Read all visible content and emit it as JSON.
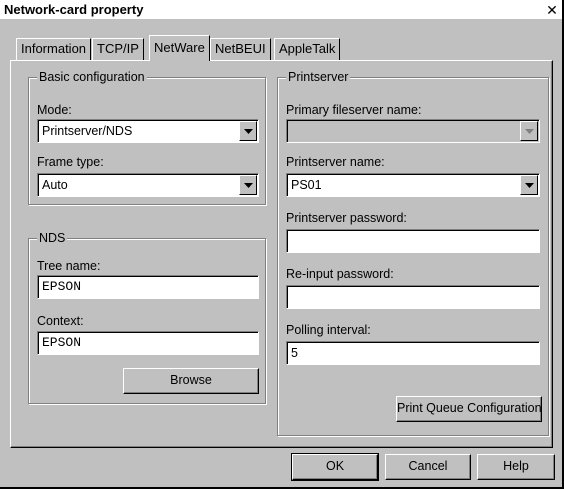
{
  "window": {
    "title": "Network-card property",
    "close_glyph": "✕"
  },
  "tabs": [
    {
      "label": "Information"
    },
    {
      "label": "TCP/IP"
    },
    {
      "label": "NetWare"
    },
    {
      "label": "NetBEUI"
    },
    {
      "label": "AppleTalk"
    }
  ],
  "active_tab": "NetWare",
  "basic": {
    "title": "Basic configuration",
    "mode_label": "Mode:",
    "mode_value": "Printserver/NDS",
    "frame_label": "Frame type:",
    "frame_value": "Auto"
  },
  "nds": {
    "title": "NDS",
    "tree_label": "Tree name:",
    "tree_value": "EPSON",
    "context_label": "Context:",
    "context_value": "EPSON",
    "browse_label": "Browse"
  },
  "printserver": {
    "title": "Printserver",
    "primary_label": "Primary fileserver name:",
    "primary_value": "",
    "name_label": "Printserver name:",
    "name_value": "PS01",
    "password_label": "Printserver password:",
    "password_value": "",
    "reinput_label": "Re-input password:",
    "reinput_value": "",
    "polling_label": "Polling interval:",
    "polling_value": "5",
    "queue_button": "Print Queue Configuration"
  },
  "footer": {
    "ok": "OK",
    "cancel": "Cancel",
    "help": "Help"
  },
  "icons": {
    "dropdown": "triangle-down-icon",
    "close": "close-icon"
  }
}
